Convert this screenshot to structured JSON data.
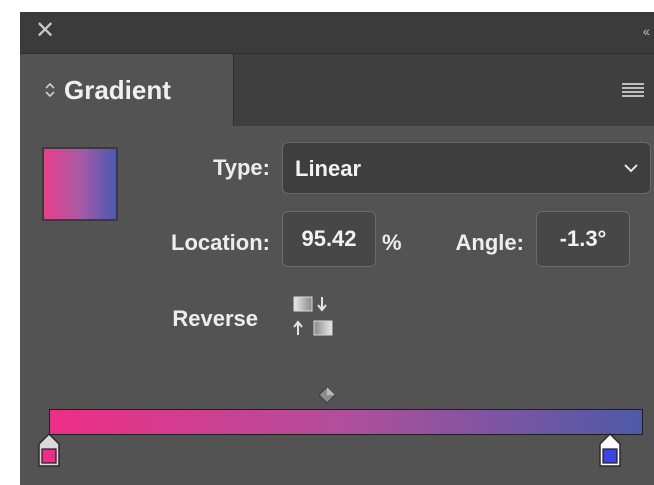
{
  "panel": {
    "close_glyph": "✕",
    "collapse_glyph": "‹‹",
    "title": "Gradient",
    "type_label": "Type:",
    "type_value": "Linear",
    "location_label": "Location:",
    "location_value": "95.42",
    "percent_sign": "%",
    "angle_label": "Angle:",
    "angle_value": "-1.3°",
    "reverse_label": "Reverse"
  },
  "gradient": {
    "start_color": "#ee2e86",
    "end_color": "#4d5aa8",
    "start_stop_color": "#ee2e86",
    "end_stop_color": "#3d45e0",
    "selected_stop": "end"
  },
  "icons": {
    "close": "close-icon",
    "collapse": "double-chevron-left-icon",
    "tab_toggle": "updown-toggle-icon",
    "menu": "hamburger-menu-icon",
    "dropdown": "chevron-down-icon",
    "reverse": "reverse-gradient-icon",
    "midpoint": "diamond-midpoint-icon"
  }
}
